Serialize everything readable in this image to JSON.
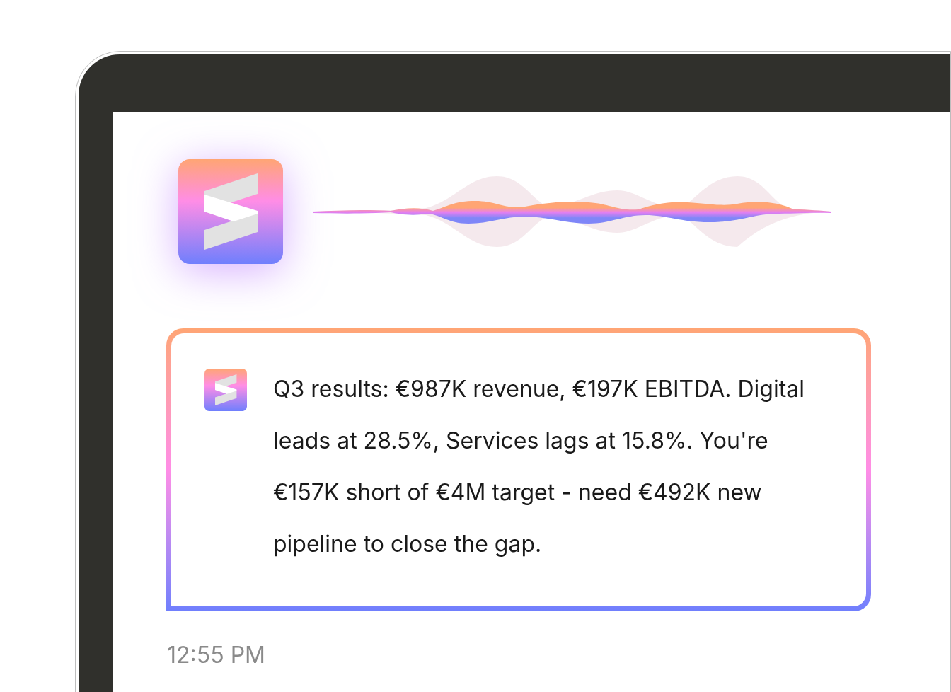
{
  "message": {
    "text": "Q3 results: €987K revenue, €197K EBITDA. Digital leads at 28.5%, Services lags at 15.8%. You're €157K short of €4M target - need €492K new pipeline to close the gap."
  },
  "timestamp": "12:55 PM"
}
